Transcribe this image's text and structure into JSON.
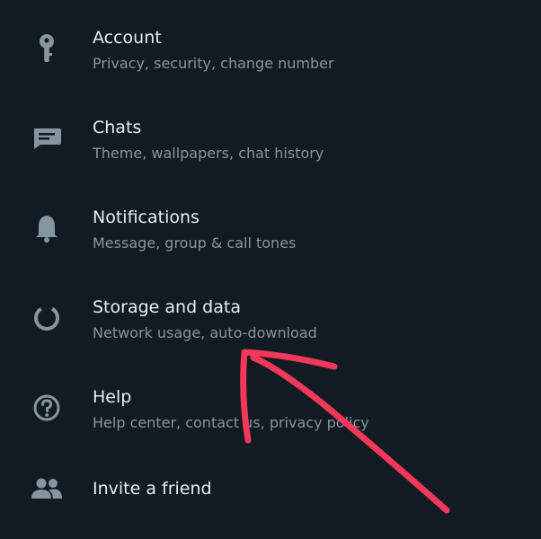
{
  "colors": {
    "background": "#111b21",
    "title_text": "#e9edef",
    "subtitle_text": "#8696a0",
    "icon": "#8696a0",
    "annotation_arrow": "#f2385a"
  },
  "settings": {
    "items": [
      {
        "icon": "key-icon",
        "title": "Account",
        "subtitle": "Privacy, security, change number"
      },
      {
        "icon": "chat-icon",
        "title": "Chats",
        "subtitle": "Theme, wallpapers, chat history"
      },
      {
        "icon": "bell-icon",
        "title": "Notifications",
        "subtitle": "Message, group & call tones"
      },
      {
        "icon": "data-usage-icon",
        "title": "Storage and data",
        "subtitle": "Network usage, auto-download"
      },
      {
        "icon": "help-icon",
        "title": "Help",
        "subtitle": "Help center, contact us, privacy policy"
      },
      {
        "icon": "people-icon",
        "title": "Invite a friend"
      }
    ]
  },
  "annotation": {
    "type": "hand-drawn-arrow",
    "points_to": "Storage and data"
  }
}
